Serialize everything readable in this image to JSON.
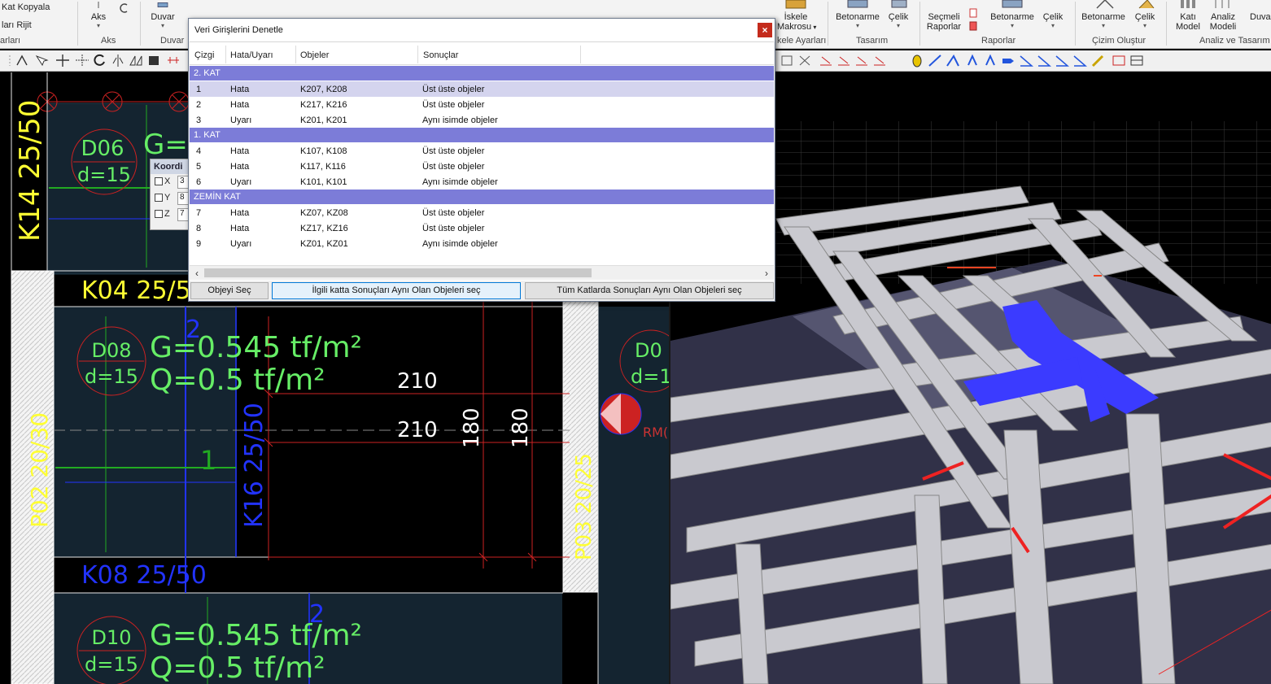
{
  "ribbon": {
    "partial_left_1": "Kat Kopyala",
    "partial_left_2": "ları Rijit",
    "aks": "Aks",
    "duvar": "Duvar",
    "iskele_makrosu_1": "İskele",
    "iskele_makrosu_2": "Makrosu",
    "betonarme_1": "Betonarme",
    "celik_1": "Çelik",
    "secmeli_raporlar_1": "Seçmeli",
    "secmeli_raporlar_2": "Raporlar",
    "betonarme_2": "Betonarme",
    "celik_2": "Çelik",
    "betonarme_3": "Betonarme",
    "celik_3": "Çelik",
    "kati_model_1": "Katı",
    "kati_model_2": "Model",
    "analiz_modeli_1": "Analiz",
    "analiz_modeli_2": "Modeli",
    "duvar_right": "Duva",
    "groups": {
      "g_arlari": "arları",
      "g_aks": "Aks",
      "g_duvar": "Duvar",
      "g_iskele": "kele Ayarları",
      "g_tasarim": "Tasarım",
      "g_raporlar": "Raporlar",
      "g_cizim": "Çizim Oluştur",
      "g_analiz": "Analiz ve Tasarım"
    }
  },
  "coord_panel": {
    "title": "Koordi",
    "x_label": "X",
    "x_value": "3",
    "y_label": "Y",
    "y_value": "8",
    "z_label": "Z",
    "z_value": "7"
  },
  "dialog": {
    "title": "Veri Girişlerini Denetle",
    "close_glyph": "×",
    "columns": [
      "Çizgi",
      "Hata/Uyarı",
      "Objeler",
      "Sonuçlar"
    ],
    "groups": [
      {
        "name": "2. KAT",
        "rows": [
          {
            "no": "1",
            "type": "Hata",
            "objects": "K207, K208",
            "result": "Üst üste objeler",
            "selected": true
          },
          {
            "no": "2",
            "type": "Hata",
            "objects": "K217, K216",
            "result": "Üst üste objeler",
            "selected": false
          },
          {
            "no": "3",
            "type": "Uyarı",
            "objects": "K201, K201",
            "result": "Aynı isimde objeler",
            "selected": false
          }
        ]
      },
      {
        "name": "1. KAT",
        "rows": [
          {
            "no": "4",
            "type": "Hata",
            "objects": "K107, K108",
            "result": "Üst üste objeler",
            "selected": false
          },
          {
            "no": "5",
            "type": "Hata",
            "objects": "K117, K116",
            "result": "Üst üste objeler",
            "selected": false
          },
          {
            "no": "6",
            "type": "Uyarı",
            "objects": "K101, K101",
            "result": "Aynı isimde objeler",
            "selected": false
          }
        ]
      },
      {
        "name": "ZEMİN KAT",
        "rows": [
          {
            "no": "7",
            "type": "Hata",
            "objects": "KZ07, KZ08",
            "result": "Üst üste objeler",
            "selected": false
          },
          {
            "no": "8",
            "type": "Hata",
            "objects": "KZ17, KZ16",
            "result": "Üst üste objeler",
            "selected": false
          },
          {
            "no": "9",
            "type": "Uyarı",
            "objects": "KZ01, KZ01",
            "result": "Aynı isimde objeler",
            "selected": false
          }
        ]
      }
    ],
    "buttons": {
      "select_object": "Objeyi Seç",
      "select_same_floor": "İlgili katta Sonuçları Aynı Olan Objeleri seç",
      "select_all_floors": "Tüm Katlarda Sonuçları Aynı Olan Objeleri seç"
    }
  },
  "cad": {
    "d06_name": "D06",
    "d06_thk": "d=15",
    "g_partial": "G=",
    "k14_label": "K14 25/50",
    "k04_label": "K04 25/5",
    "d08_name": "D08",
    "d08_thk": "d=15",
    "d08_g": "G=0.545 tf/m²",
    "d08_q": "Q=0.5 tf/m²",
    "d09_name": "D0",
    "d09_thk": "d=1",
    "dim_210_a": "210",
    "dim_210_b": "210",
    "dim_180_a": "180",
    "dim_180_b": "180",
    "p02_label": "P02 20/30",
    "p03_label": "P03 20/25",
    "k16_label": "K16 25/50",
    "k07_label": "K08 25/50",
    "d10_name": "D10",
    "d10_thk": "d=15",
    "d10_g": "G=0.545 tf/m²",
    "d10_q": "Q=0.5 tf/m²",
    "axis_2_a": "2",
    "axis_2_b": "2",
    "axis_1": "1",
    "rm_label": "RM("
  },
  "colors": {
    "dialog_group_bg": "#7c7cd8",
    "selected_row_bg": "#d4d4ee",
    "cad_green": "#66dd66",
    "cad_yellow": "#ffff33",
    "cad_blue": "#2233ff",
    "highlight_beam": "#3b3bff"
  }
}
